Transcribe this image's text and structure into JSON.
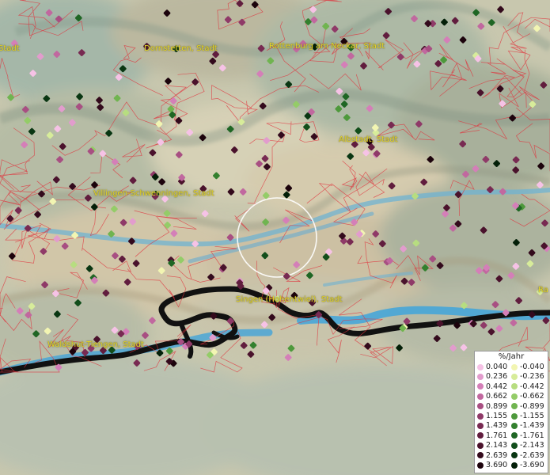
{
  "map": {
    "place_labels": [
      {
        "name": "Stadt"
      },
      {
        "name": "Dornstetten, Stadt"
      },
      {
        "name": "Rottenburg am Neckar, Stadt"
      },
      {
        "name": "Albstadt, Stadt"
      },
      {
        "name": "Villingen-Schwenningen, Stadt"
      },
      {
        "name": "Singen (Hohentwiel), Stadt"
      },
      {
        "name": "Waldshut-Tiengen, Stadt"
      },
      {
        "name": "Ra"
      }
    ]
  },
  "legend": {
    "title": "%/Jahr",
    "positive": [
      {
        "label": "0.040",
        "color": "#f6c2e6"
      },
      {
        "label": "0.236",
        "color": "#e29ccd"
      },
      {
        "label": "0.442",
        "color": "#d47fb8"
      },
      {
        "label": "0.662",
        "color": "#c1689f"
      },
      {
        "label": "0.899",
        "color": "#a84f82"
      },
      {
        "label": "1.155",
        "color": "#8f3a68"
      },
      {
        "label": "1.439",
        "color": "#782a52"
      },
      {
        "label": "1.761",
        "color": "#611d3e"
      },
      {
        "label": "2.143",
        "color": "#4a122c"
      },
      {
        "label": "2.639",
        "color": "#330a1c"
      },
      {
        "label": "3.690",
        "color": "#1c030c"
      }
    ],
    "negative": [
      {
        "label": "-0.040",
        "color": "#f2f5b2"
      },
      {
        "label": "-0.236",
        "color": "#d7ec9a"
      },
      {
        "label": "-0.442",
        "color": "#b7dd80"
      },
      {
        "label": "-0.662",
        "color": "#94cc68"
      },
      {
        "label": "-0.899",
        "color": "#70b450"
      },
      {
        "label": "-1.155",
        "color": "#4e993c"
      },
      {
        "label": "-1.439",
        "color": "#33802e"
      },
      {
        "label": "-1.761",
        "color": "#1f6624"
      },
      {
        "label": "-2.143",
        "color": "#124e1b"
      },
      {
        "label": "-2.639",
        "color": "#093612"
      },
      {
        "label": "-3.690",
        "color": "#031f08"
      }
    ]
  }
}
